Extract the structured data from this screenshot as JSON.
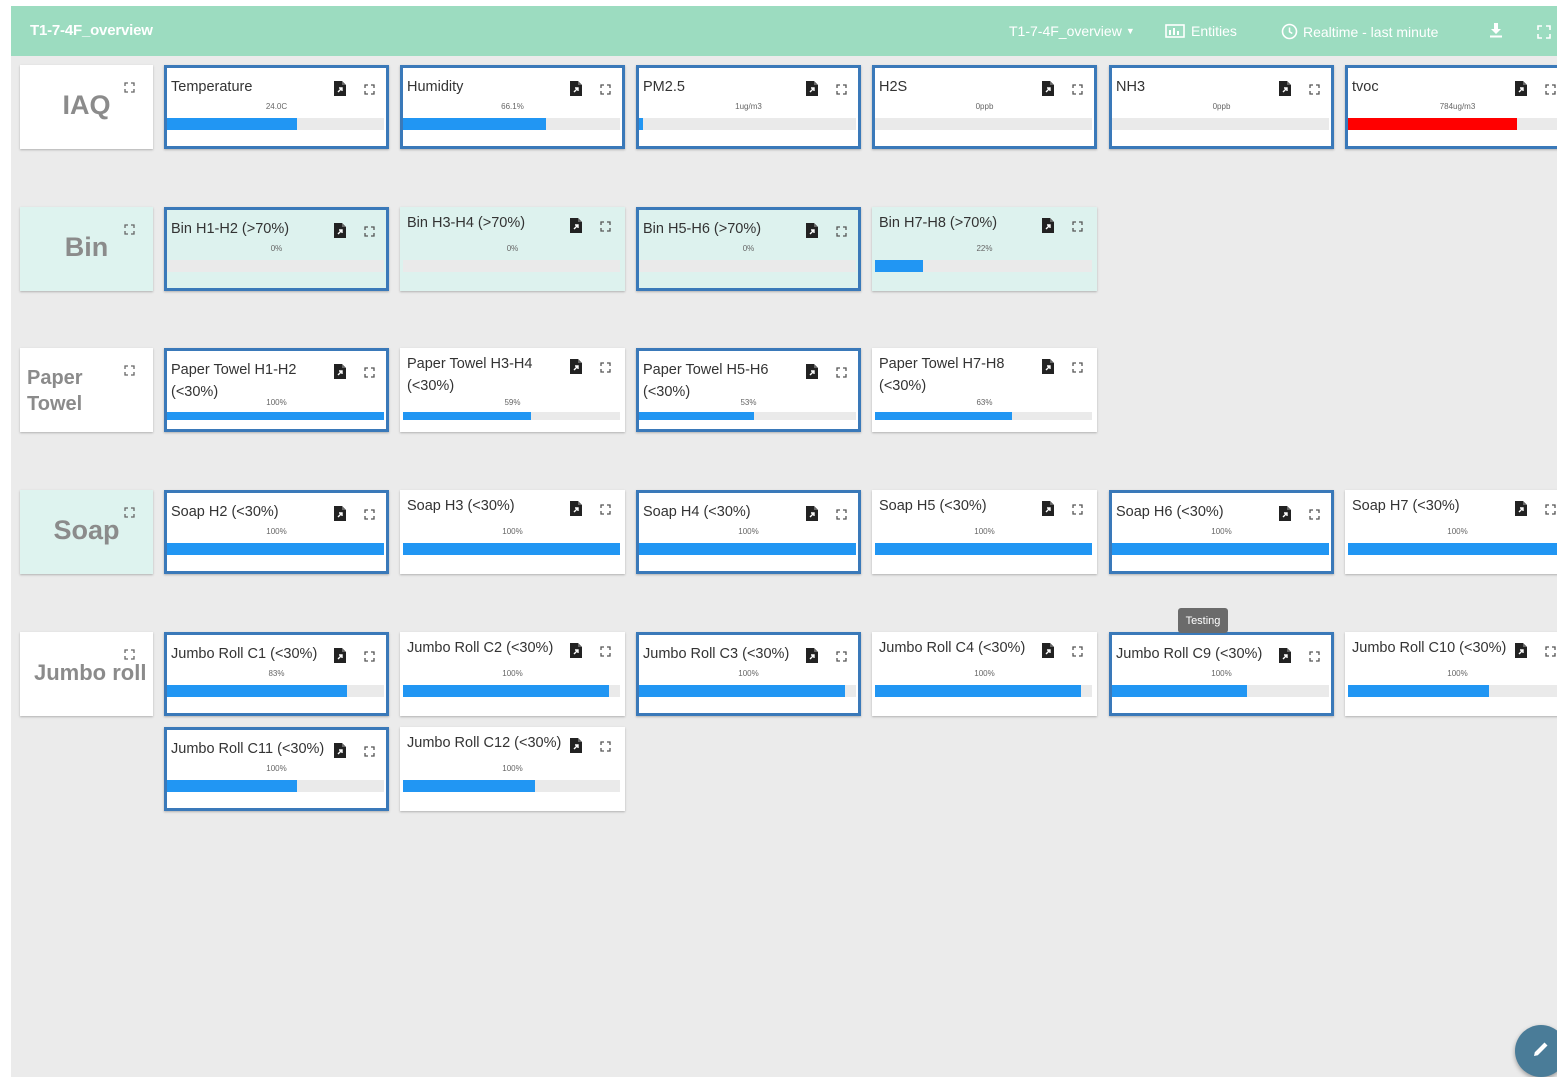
{
  "header": {
    "title": "T1-7-4F_overview",
    "dashboard_select": "T1-7-4F_overview",
    "entities_label": "Entities",
    "timewindow_label": "Realtime - last minute"
  },
  "rows": [
    {
      "label": "IAQ",
      "widgets": [
        {
          "title": "Temperature",
          "value": "24.0C",
          "fill": 0.6
        },
        {
          "title": "Humidity",
          "value": "66.1%",
          "fill": 0.661
        },
        {
          "title": "PM2.5",
          "value": "1ug/m3",
          "fill": 0.02
        },
        {
          "title": "H2S",
          "value": "0ppb",
          "fill": 0
        },
        {
          "title": "NH3",
          "value": "0ppb",
          "fill": 0
        },
        {
          "title": "tvoc",
          "value": "784ug/m3",
          "fill": 0.78
        }
      ]
    },
    {
      "label": "Bin",
      "widgets": [
        {
          "title": "Bin H1-H2 (>70%)",
          "value": "0%",
          "fill": 0
        },
        {
          "title": "Bin H3-H4 (>70%)",
          "value": "0%",
          "fill": 0
        },
        {
          "title": "Bin H5-H6 (>70%)",
          "value": "0%",
          "fill": 0
        },
        {
          "title": "Bin H7-H8 (>70%)",
          "value": "22%",
          "fill": 0.22
        }
      ]
    },
    {
      "label": "Paper Towel",
      "widgets": [
        {
          "title": "Paper Towel H1-H2 (<30%)",
          "value": "100%",
          "fill": 1.0
        },
        {
          "title": "Paper Towel H3-H4 (<30%)",
          "value": "59%",
          "fill": 0.59
        },
        {
          "title": "Paper Towel H5-H6 (<30%)",
          "value": "53%",
          "fill": 0.53
        },
        {
          "title": "Paper Towel H7-H8 (<30%)",
          "value": "63%",
          "fill": 0.63
        }
      ]
    },
    {
      "label": "Soap",
      "widgets": [
        {
          "title": "Soap H2 (<30%)",
          "value": "100%",
          "fill": 1.0
        },
        {
          "title": "Soap H3 (<30%)",
          "value": "100%",
          "fill": 1.0
        },
        {
          "title": "Soap H4 (<30%)",
          "value": "100%",
          "fill": 1.0
        },
        {
          "title": "Soap H5 (<30%)",
          "value": "100%",
          "fill": 1.0
        },
        {
          "title": "Soap H6 (<30%)",
          "value": "100%",
          "fill": 1.0
        },
        {
          "title": "Soap H7 (<30%)",
          "value": "100%",
          "fill": 1.0
        }
      ]
    },
    {
      "label": "Jumbo roll",
      "widgets": [
        {
          "title": "Jumbo Roll C1 (<30%)",
          "value": "83%",
          "fill": 0.83
        },
        {
          "title": "Jumbo Roll C2 (<30%)",
          "value": "100%",
          "fill": 0.95
        },
        {
          "title": "Jumbo Roll C3 (<30%)",
          "value": "100%",
          "fill": 0.95
        },
        {
          "title": "Jumbo Roll C4 (<30%)",
          "value": "100%",
          "fill": 0.95
        },
        {
          "title": "Jumbo Roll C9 (<30%)",
          "value": "100%",
          "fill": 0.62
        },
        {
          "title": "Jumbo Roll C10 (<30%)",
          "value": "100%",
          "fill": 0.65
        },
        {
          "title": "Jumbo Roll C11 (<30%)",
          "value": "100%",
          "fill": 0.6
        },
        {
          "title": "Jumbo Roll C12 (<30%)",
          "value": "100%",
          "fill": 0.61
        }
      ]
    }
  ],
  "tooltip": "Testing",
  "colors": {
    "header": "#9cdcc0",
    "bar": "#2196f3",
    "alarm_bar": "#ff0000",
    "selected_border": "#3a79b9",
    "teal_card": "#def3ef"
  },
  "icons": [
    "fullscreen-icon",
    "document-export-icon",
    "entities-icon",
    "clock-icon",
    "download-icon",
    "edit-icon"
  ]
}
